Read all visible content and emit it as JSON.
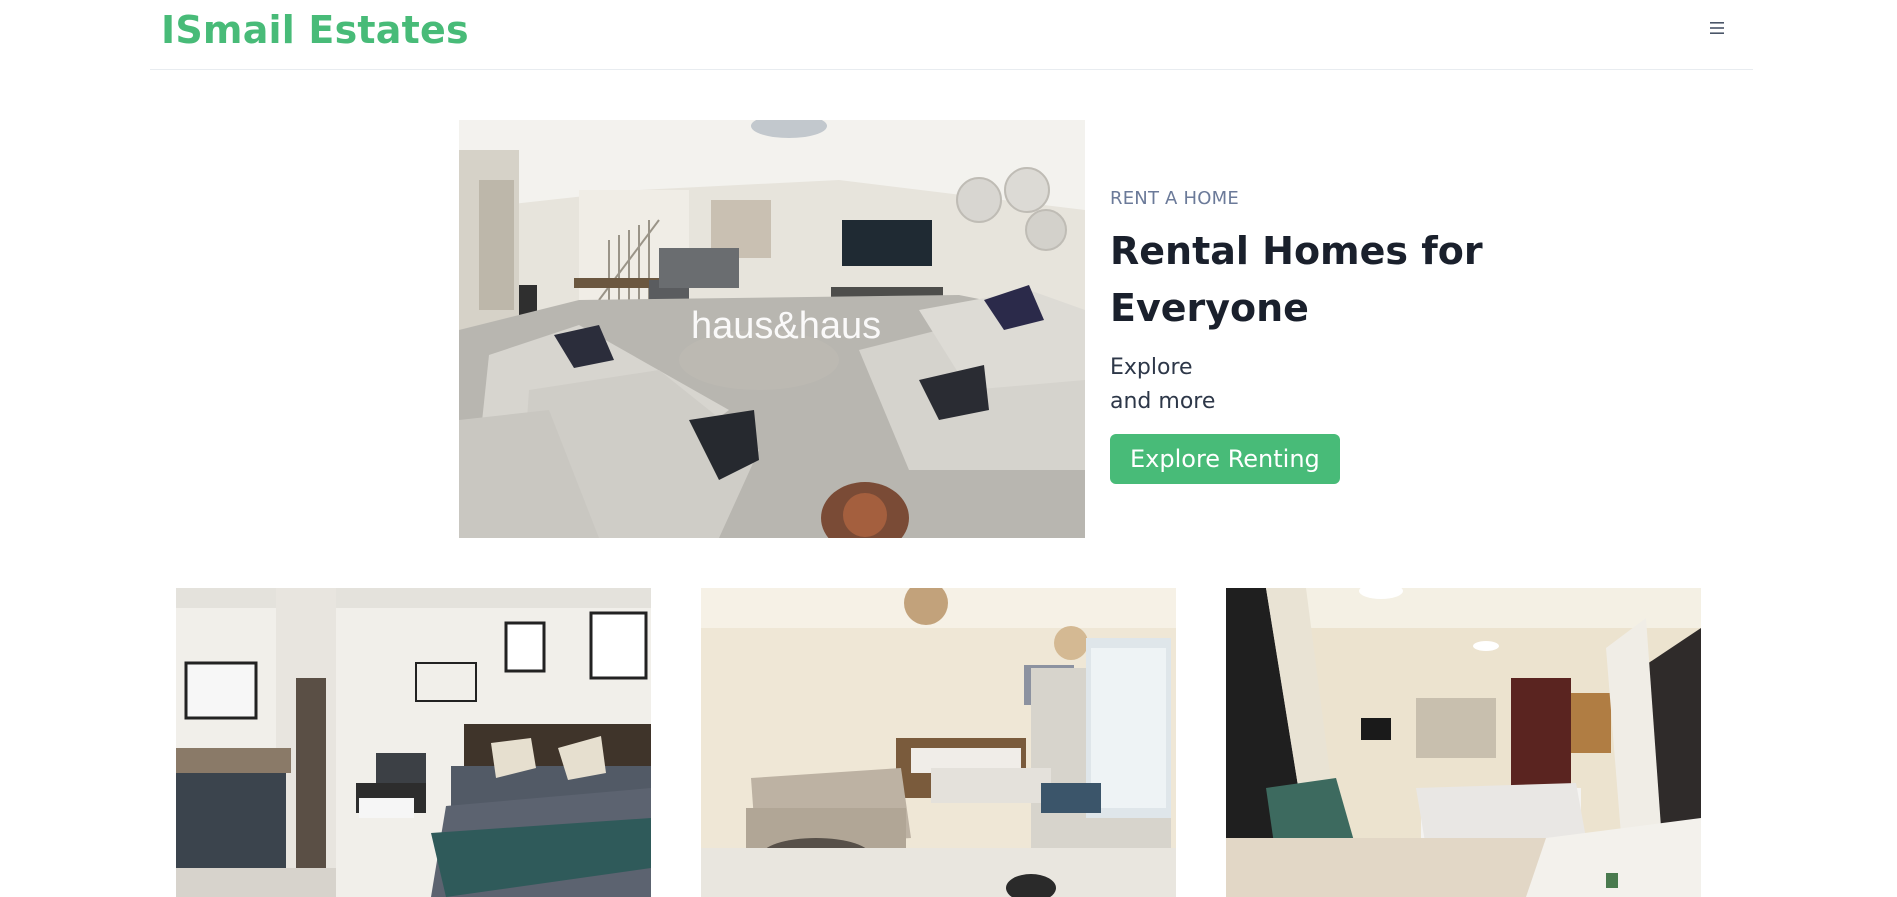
{
  "header": {
    "brand": "ISmail Estates",
    "menu_icon": "hamburger-menu-icon"
  },
  "hero": {
    "image_watermark": "haus&haus",
    "eyebrow": "RENT A HOME",
    "headline": "Rental Homes for Everyone",
    "description_line1": "Explore",
    "description_line2": "and more",
    "cta_label": "Explore Renting"
  },
  "listings": [
    {
      "image": "bedroom-with-teal-throw-photo"
    },
    {
      "image": "studio-with-sofa-and-bed-photo"
    },
    {
      "image": "studio-with-kitchen-and-bed-photo"
    }
  ],
  "colors": {
    "brand": "#48bb78",
    "heading": "#1a202c",
    "eyebrow": "#6b7a99"
  }
}
